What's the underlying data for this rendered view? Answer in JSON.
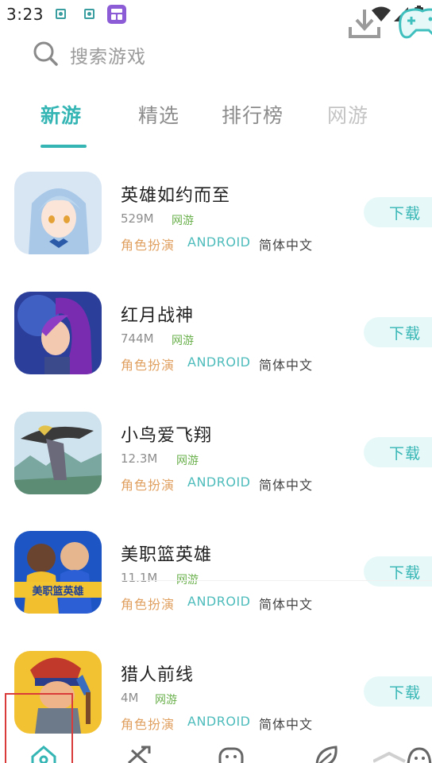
{
  "status_bar": {
    "time": "3:23"
  },
  "search": {
    "placeholder": "搜索游戏"
  },
  "tabs": [
    {
      "label": "新游",
      "active": true
    },
    {
      "label": "精选",
      "active": false
    },
    {
      "label": "排行榜",
      "active": false
    },
    {
      "label": "网游",
      "active": false
    }
  ],
  "games": [
    {
      "name": "英雄如约而至",
      "size": "529M",
      "type": "网游",
      "genre": "角色扮演",
      "platform": "ANDROID",
      "language": "简体中文",
      "download_label": "下载"
    },
    {
      "name": "红月战神",
      "size": "744M",
      "type": "网游",
      "genre": "角色扮演",
      "platform": "ANDROID",
      "language": "简体中文",
      "download_label": "下载"
    },
    {
      "name": "小鸟爱飞翔",
      "size": "12.3M",
      "type": "网游",
      "genre": "角色扮演",
      "platform": "ANDROID",
      "language": "简体中文",
      "download_label": "下载"
    },
    {
      "name": "美职篮英雄",
      "size": "11.1M",
      "type": "网游",
      "genre": "角色扮演",
      "platform": "ANDROID",
      "language": "简体中文",
      "download_label": "下载",
      "icon_text": "美职篮英雄"
    },
    {
      "name": "猎人前线",
      "size": "4M",
      "type": "网游",
      "genre": "角色扮演",
      "platform": "ANDROID",
      "language": "简体中文",
      "download_label": "下载"
    }
  ],
  "bottom_nav": [
    {
      "icon": "home-icon",
      "active": true
    },
    {
      "icon": "sword-icon",
      "active": false
    },
    {
      "icon": "face-icon",
      "active": false
    },
    {
      "icon": "leaf-icon",
      "active": false
    },
    {
      "icon": "ghost-icon",
      "active": false
    }
  ],
  "colors": {
    "accent": "#35b6b5",
    "genre_tag": "#e0a060",
    "type_tag": "#6ab04c",
    "highlight_box": "#d93a3a"
  }
}
